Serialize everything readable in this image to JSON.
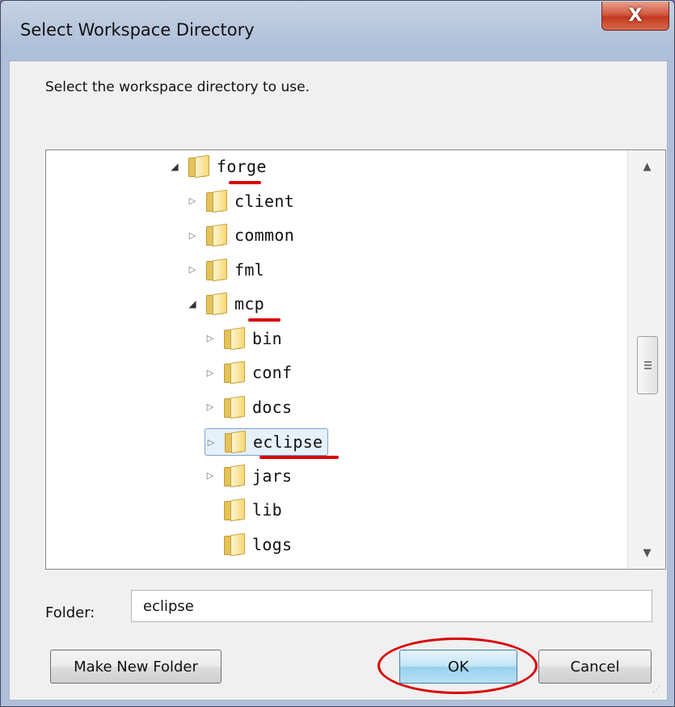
{
  "window": {
    "title": "Select Workspace Directory",
    "close_label": "X"
  },
  "instruction": "Select the workspace directory to use.",
  "tree": {
    "rows": [
      {
        "label": "forge",
        "expanded": true,
        "has_children": true,
        "level": 0
      },
      {
        "label": "client",
        "expanded": false,
        "has_children": true,
        "level": 1
      },
      {
        "label": "common",
        "expanded": false,
        "has_children": true,
        "level": 1
      },
      {
        "label": "fml",
        "expanded": false,
        "has_children": true,
        "level": 1
      },
      {
        "label": "mcp",
        "expanded": true,
        "has_children": true,
        "level": 1
      },
      {
        "label": "bin",
        "expanded": false,
        "has_children": true,
        "level": 2
      },
      {
        "label": "conf",
        "expanded": false,
        "has_children": true,
        "level": 2
      },
      {
        "label": "docs",
        "expanded": false,
        "has_children": true,
        "level": 2
      },
      {
        "label": "eclipse",
        "expanded": false,
        "has_children": true,
        "level": 2,
        "selected": true
      },
      {
        "label": "jars",
        "expanded": false,
        "has_children": true,
        "level": 2
      },
      {
        "label": "lib",
        "expanded": false,
        "has_children": false,
        "level": 2
      },
      {
        "label": "logs",
        "expanded": false,
        "has_children": false,
        "level": 2
      }
    ]
  },
  "folder": {
    "label": "Folder:",
    "value": "eclipse"
  },
  "buttons": {
    "make_new_folder": "Make New Folder",
    "ok": "OK",
    "cancel": "Cancel"
  },
  "colors": {
    "annotation_red": "#d80000",
    "selection_bg": "#e5f1fb",
    "ok_button_blue": "#98d1ef"
  }
}
